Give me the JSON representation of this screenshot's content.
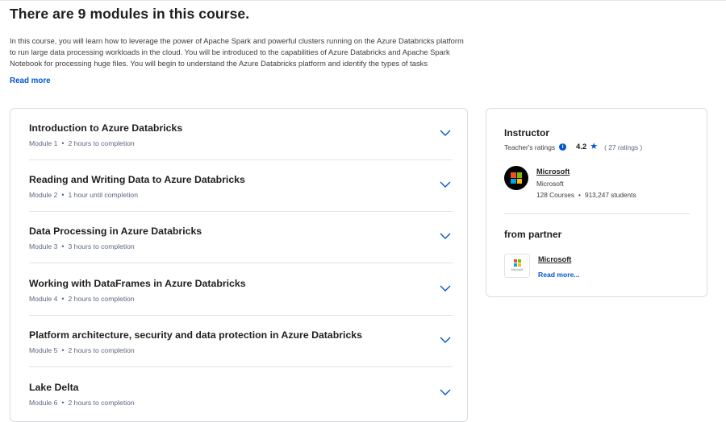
{
  "page": {
    "title": "There are 9 modules in this course.",
    "description": "In this course, you will learn how to leverage the power of Apache Spark and powerful clusters running on the Azure Databricks platform to run large data processing workloads in the cloud. You will be introduced to the capabilities of Azure Databricks and Apache Spark Notebook for processing huge files. You will begin to understand the Azure Databricks platform and identify the types of tasks",
    "read_more": "Read more"
  },
  "modules": [
    {
      "title": "Introduction to Azure Databricks",
      "number": "Module 1",
      "duration": "2 hours to completion"
    },
    {
      "title": "Reading and Writing Data to Azure Databricks",
      "number": "Module 2",
      "duration": "1 hour until completion"
    },
    {
      "title": "Data Processing in Azure Databricks",
      "number": "Module 3",
      "duration": "3 hours to completion"
    },
    {
      "title": "Working with DataFrames in Azure Databricks",
      "number": "Module 4",
      "duration": "2 hours to completion"
    },
    {
      "title": "Platform architecture, security and data protection in Azure Databricks",
      "number": "Module 5",
      "duration": "2 hours to completion"
    },
    {
      "title": "Lake Delta",
      "number": "Module 6",
      "duration": "2 hours to completion"
    }
  ],
  "meta_separator": "•",
  "instructor": {
    "heading": "Instructor",
    "ratings_label": "Teacher's ratings",
    "info_glyph": "i",
    "rating": "4.2",
    "star_glyph": "★",
    "rating_count": "( 27 ratings )",
    "name": "Microsoft",
    "org": "Microsoft",
    "courses": "128 Courses",
    "stats_separator": "•",
    "students": "913,247 students"
  },
  "partner": {
    "heading": "from partner",
    "name": "Microsoft",
    "logo_text": "Microsoft",
    "read_more": "Read more..."
  },
  "colors": {
    "accent": "#0056d2",
    "ms_red": "#f25022",
    "ms_green": "#7fba00",
    "ms_blue": "#00a4ef",
    "ms_yellow": "#ffb900"
  },
  "icons": {
    "chevron": "chevron-down-icon",
    "info": "info-icon",
    "star": "star-icon"
  }
}
